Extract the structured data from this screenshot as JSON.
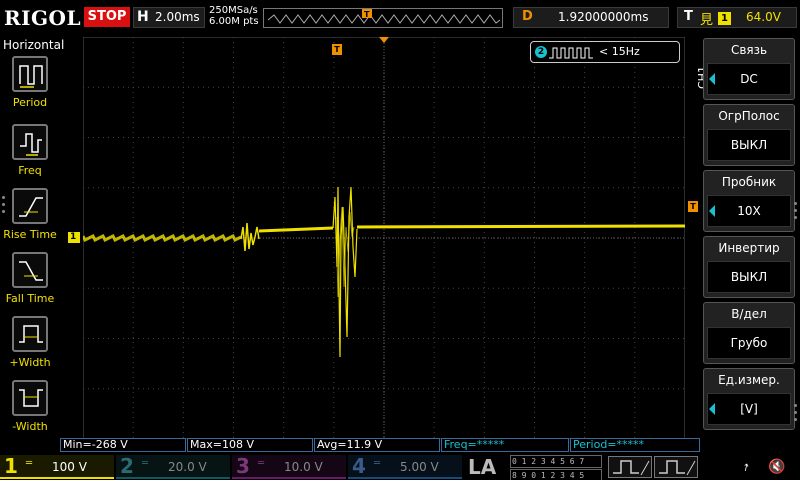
{
  "top": {
    "brand": "RIGOL",
    "run_state": "STOP",
    "timebase_label": "H",
    "timebase_value": "2.00ms",
    "sample_rate": "250MSa/s",
    "memory_depth": "6.00M pts",
    "delay_label": "D",
    "delay_value": "1.92000000ms",
    "trigger_label": "T",
    "trigger_source": "1",
    "trigger_level": "64.0V",
    "colors": {
      "stop": "#d81010",
      "ch1": "#f0e000",
      "ch2": "#19c0d0",
      "trigger": "#f09000"
    }
  },
  "left_panel": {
    "title": "Horizontal",
    "items": [
      {
        "label": "Period",
        "icon": "period-icon"
      },
      {
        "label": "Freq",
        "icon": "freq-icon"
      },
      {
        "label": "Rise Time",
        "icon": "rise-time-icon"
      },
      {
        "label": "Fall Time",
        "icon": "fall-time-icon"
      },
      {
        "label": "+Width",
        "icon": "positive-width-icon"
      },
      {
        "label": "-Width",
        "icon": "negative-width-icon"
      }
    ]
  },
  "plot": {
    "channel_tag": "CH1",
    "ch1_marker": "1",
    "trigger_marker": "T",
    "freq_indicator": {
      "channel": "2",
      "text": "< 15Hz"
    }
  },
  "right_menu": {
    "items": [
      {
        "title": "Связь",
        "value": "DC",
        "has_arrow": true
      },
      {
        "title": "ОгрПолос",
        "value": "ВЫКЛ",
        "has_arrow": false
      },
      {
        "title": "Пробник",
        "value": "10X",
        "has_arrow": true
      },
      {
        "title": "Инвертир",
        "value": "ВЫКЛ",
        "has_arrow": false
      },
      {
        "title": "В/дел",
        "value": "Грубо",
        "has_arrow": false
      },
      {
        "title": "Ед.измер.",
        "value": "[V]",
        "has_arrow": true
      }
    ]
  },
  "measurements": {
    "min": "Min=-268 V",
    "max": "Max=108 V",
    "avg": "Avg=11.9 V",
    "freq": "Freq=*****",
    "period": "Period=*****"
  },
  "bottom": {
    "channels": [
      {
        "num": "1",
        "scale": "100 V"
      },
      {
        "num": "2",
        "scale": "20.0 V"
      },
      {
        "num": "3",
        "scale": "10.0 V"
      },
      {
        "num": "4",
        "scale": "5.00 V"
      }
    ],
    "la_label": "LA",
    "la_rows": [
      "0 1 2 3  4 5 6 7",
      "8 9 0 1  2 3 4 5"
    ]
  }
}
